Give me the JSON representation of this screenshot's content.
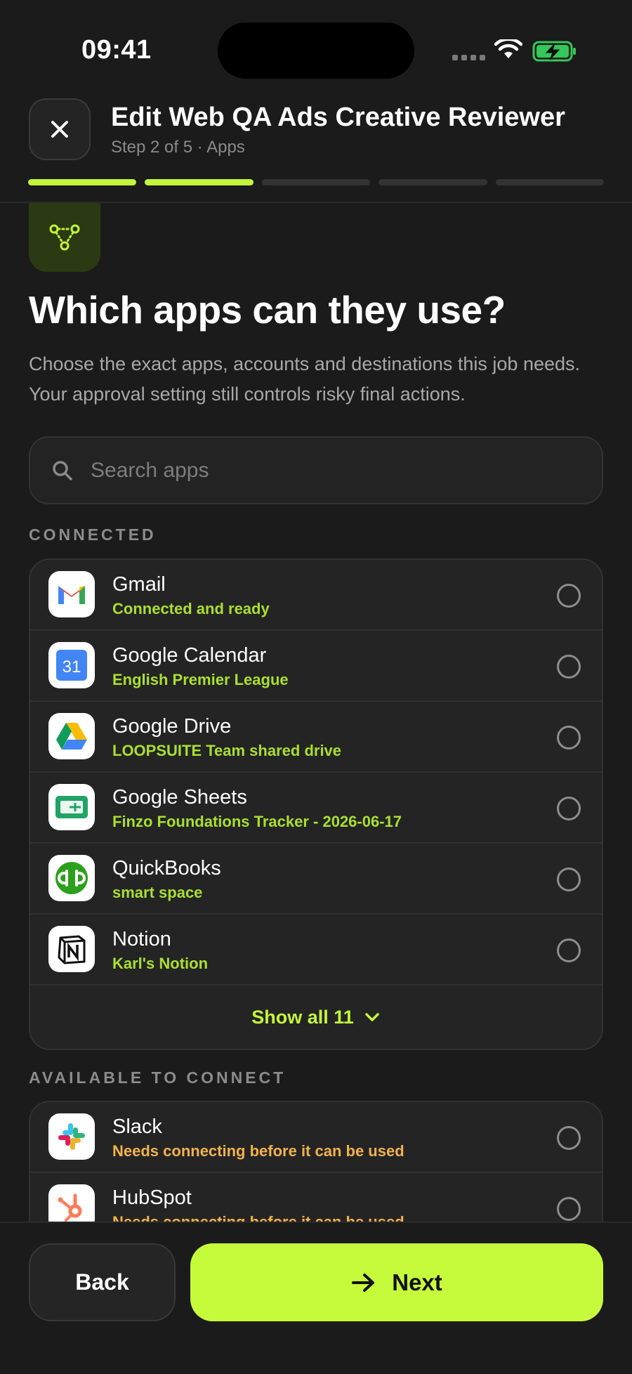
{
  "status_bar": {
    "time": "09:41"
  },
  "header": {
    "title": "Edit Web QA Ads Creative Reviewer",
    "subtitle": "Step 2 of 5 · Apps",
    "steps_total": 5,
    "steps_completed": 2,
    "accent_color": "#c4f53a"
  },
  "hero": {
    "icon": "connections-icon",
    "title": "Which apps can they use?",
    "description": "Choose the exact apps, accounts and destinations this job needs. Your approval setting still controls risky final actions."
  },
  "search": {
    "placeholder": "Search apps",
    "value": ""
  },
  "connected": {
    "label": "CONNECTED",
    "apps": [
      {
        "name": "Gmail",
        "detail": "Connected and ready",
        "icon": "gmail-icon",
        "selected": false
      },
      {
        "name": "Google Calendar",
        "detail": "English Premier League",
        "icon": "google-calendar-icon",
        "selected": false
      },
      {
        "name": "Google Drive",
        "detail": "LOOPSUITE Team shared drive",
        "icon": "google-drive-icon",
        "selected": false
      },
      {
        "name": "Google Sheets",
        "detail": "Finzo Foundations Tracker - 2026-06-17",
        "icon": "google-sheets-icon",
        "selected": false
      },
      {
        "name": "QuickBooks",
        "detail": "smart space",
        "icon": "quickbooks-icon",
        "selected": false
      },
      {
        "name": "Notion",
        "detail": "Karl's Notion",
        "icon": "notion-icon",
        "selected": false
      }
    ],
    "show_all_label": "Show all 11"
  },
  "available": {
    "label": "AVAILABLE TO CONNECT",
    "apps": [
      {
        "name": "Slack",
        "detail": "Needs connecting before it can be used",
        "icon": "slack-icon",
        "selected": false
      },
      {
        "name": "HubSpot",
        "detail": "Needs connecting before it can be used",
        "icon": "hubspot-icon",
        "selected": false
      }
    ]
  },
  "footer": {
    "back_label": "Back",
    "next_label": "Next"
  }
}
